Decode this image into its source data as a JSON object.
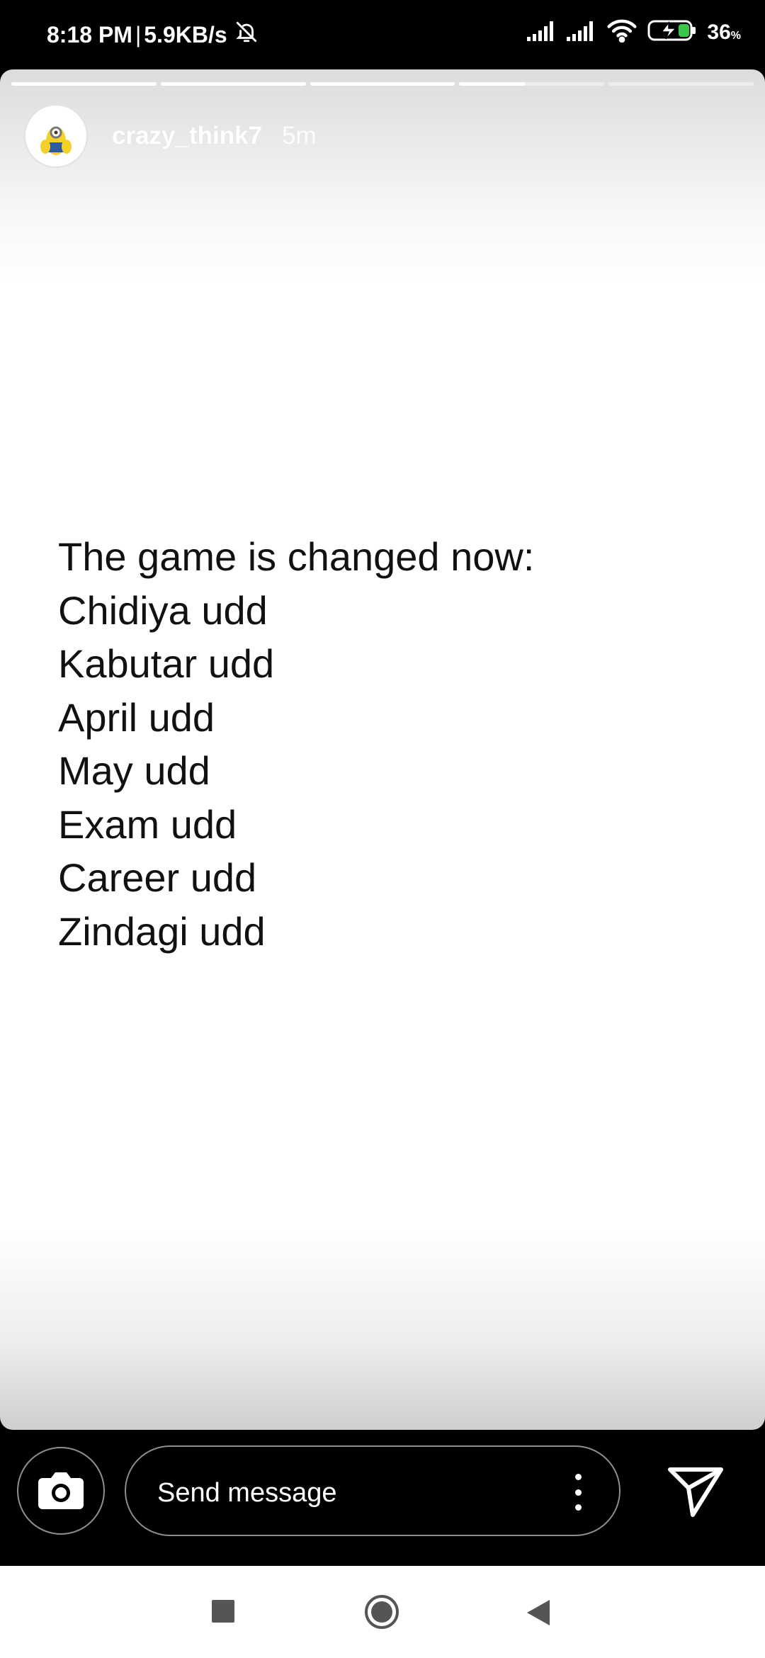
{
  "status_bar": {
    "time": "8:18 PM",
    "separator": "|",
    "network_speed": "5.9KB/s",
    "battery_percent": "36",
    "battery_unit": "%",
    "icons": [
      "bell-off-icon",
      "signal-icon",
      "signal-icon",
      "wifi-icon",
      "battery-charging-icon"
    ]
  },
  "story": {
    "progress_segments": [
      1,
      1,
      1,
      0.45,
      0
    ],
    "username": "crazy_think7",
    "time_ago": "5m",
    "lines": [
      "The game is changed now:",
      "Chidiya udd",
      "Kabutar udd",
      "April udd",
      "May udd",
      "Exam udd",
      "Career udd",
      "Zindagi udd"
    ]
  },
  "bottom_bar": {
    "message_placeholder": "Send message",
    "icons": [
      "camera-icon",
      "more-vertical-icon",
      "send-icon"
    ]
  },
  "nav_bar": {
    "icons": [
      "recents-icon",
      "home-icon",
      "back-icon"
    ]
  }
}
